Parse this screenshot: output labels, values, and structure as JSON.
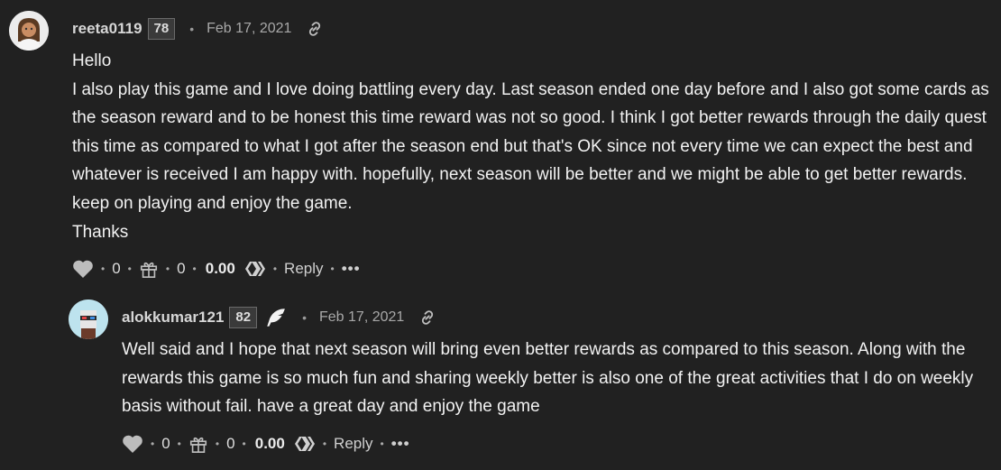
{
  "comments": [
    {
      "author": "reeta0119",
      "reputation": "78",
      "date": "Feb 17, 2021",
      "paragraphs": [
        "Hello",
        "I also play this game and I love doing battling every day. Last season ended one day before and I also got some cards as the season reward and to be honest this time reward was not so good. I think I got better rewards through the daily quest this time as compared to what I got after the season end but that's OK since not every time we can expect the best and whatever is received I am happy with. hopefully, next season will be better and we might be able to get better rewards. keep on playing and enjoy the game.",
        "Thanks"
      ],
      "votes": "0",
      "gifts": "0",
      "payout": "0.00",
      "reply_label": "Reply",
      "more_label": "•••"
    },
    {
      "author": "alokkumar121",
      "reputation": "82",
      "date": "Feb 17, 2021",
      "paragraphs": [
        "Well said and I hope that next season will bring even better rewards as compared to this season. Along with the rewards this game is so much fun and sharing weekly better is also one of the great activities that I do on weekly basis without fail. have a great day and enjoy the game"
      ],
      "votes": "0",
      "gifts": "0",
      "payout": "0.00",
      "reply_label": "Reply",
      "more_label": "•••"
    }
  ],
  "separator": "•",
  "icons": {
    "vote": "heart-icon",
    "gift": "gift-icon",
    "payout": "hive-logo-icon",
    "permalink": "link-icon",
    "badge": "feather-icon"
  }
}
